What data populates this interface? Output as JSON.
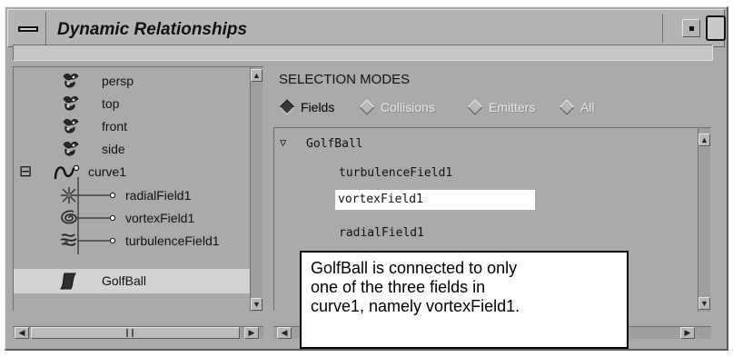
{
  "window": {
    "title": "Dynamic Relationships"
  },
  "outliner": {
    "items": [
      {
        "label": "persp",
        "icon": "camera-icon"
      },
      {
        "label": "top",
        "icon": "camera-icon"
      },
      {
        "label": "front",
        "icon": "camera-icon"
      },
      {
        "label": "side",
        "icon": "camera-icon"
      },
      {
        "label": "curve1",
        "icon": "curve-icon",
        "expander": "⊟"
      },
      {
        "label": "radialField1",
        "icon": "radial-field-icon"
      },
      {
        "label": "vortexField1",
        "icon": "vortex-field-icon"
      },
      {
        "label": "turbulenceField1",
        "icon": "turbulence-field-icon"
      },
      {
        "label": "GolfBall",
        "icon": "nurbs-surface-icon",
        "selected": true
      }
    ]
  },
  "selection": {
    "title": "SELECTION MODES",
    "modes": [
      {
        "label": "Fields",
        "active": true
      },
      {
        "label": "Collisions",
        "active": false
      },
      {
        "label": "Emitters",
        "active": false
      },
      {
        "label": "All",
        "active": false
      }
    ]
  },
  "fields_list": {
    "parent": "GolfBall",
    "items": [
      {
        "label": "turbulenceField1",
        "highlighted": false
      },
      {
        "label": "vortexField1",
        "highlighted": true
      },
      {
        "label": "radialField1",
        "highlighted": false
      }
    ]
  },
  "callout": {
    "lines": [
      "GolfBall is connected to only",
      "one of the three fields in",
      "curve1, namely vortexField1."
    ]
  }
}
